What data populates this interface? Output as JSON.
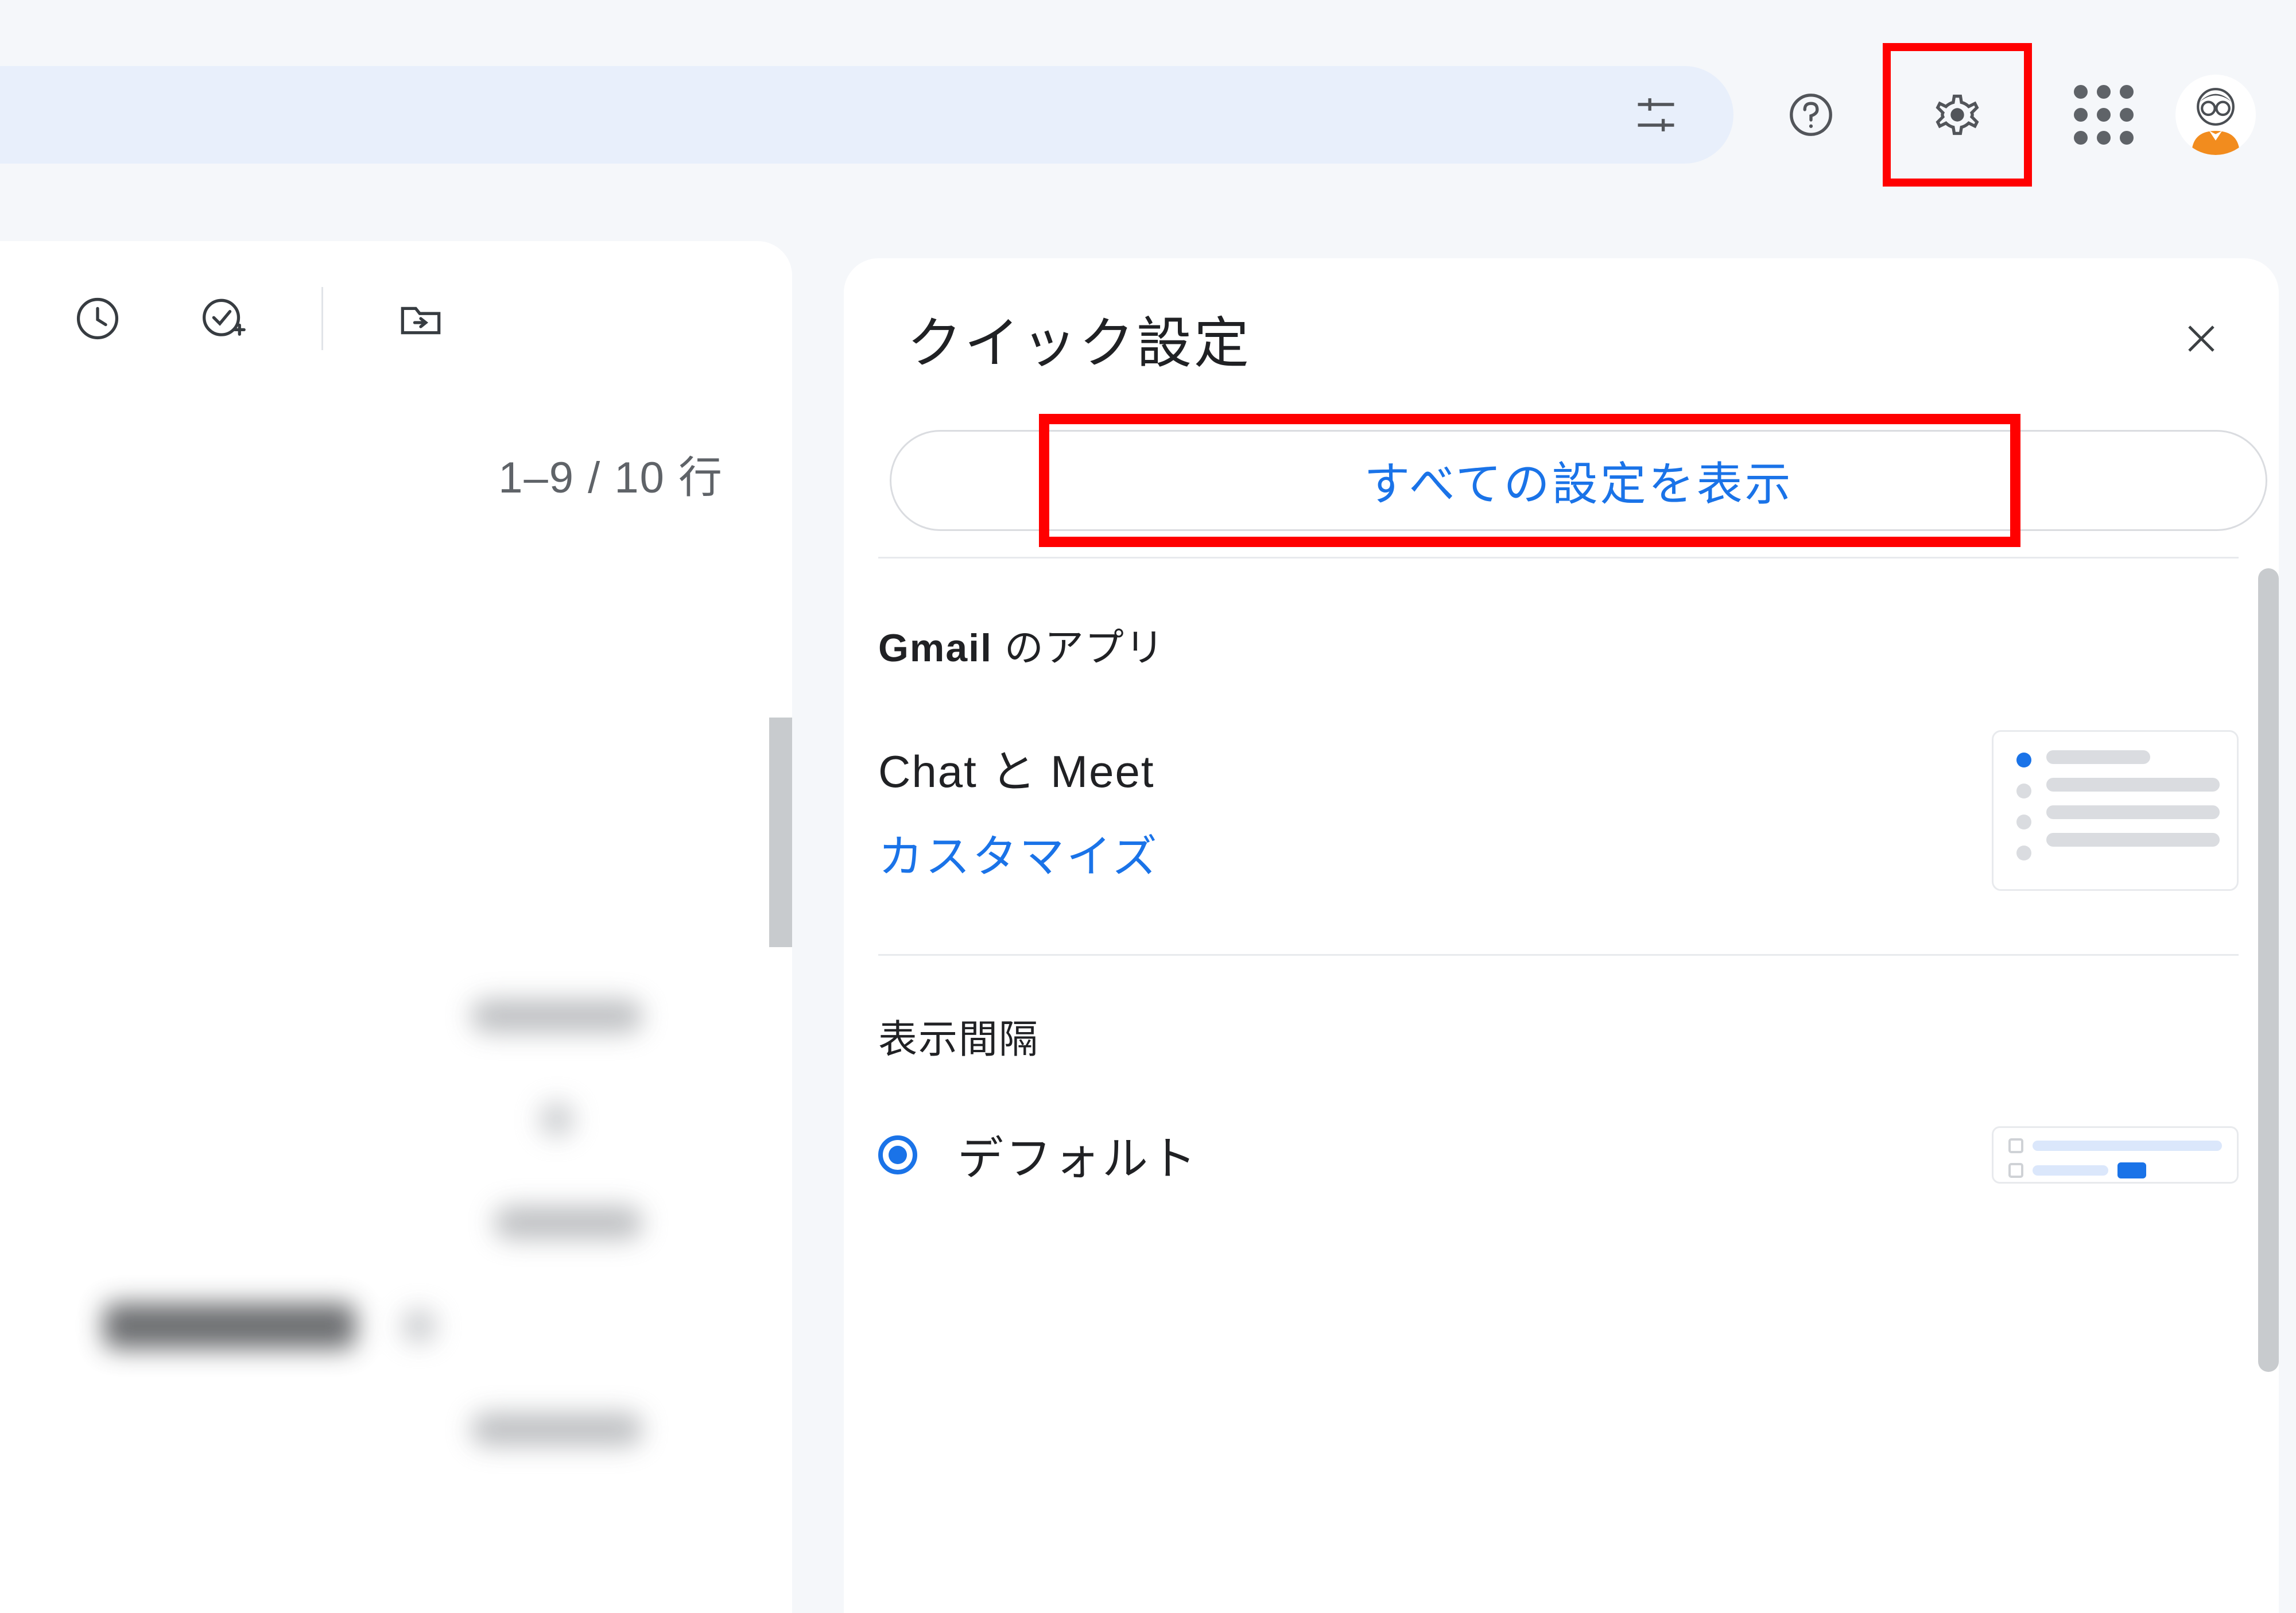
{
  "header": {
    "icons": {
      "tuner": "advanced-search-icon",
      "help": "help-icon",
      "settings": "settings-gear-icon",
      "apps": "google-apps-icon",
      "avatar": "account-avatar"
    }
  },
  "left": {
    "pagination": "1–9 / 10 行"
  },
  "settings_panel": {
    "title": "クイック設定",
    "show_all": "すべての設定を表示",
    "section_apps": {
      "title_bold": "Gmail",
      "title_rest": " のアプリ",
      "chat_meet_label": "Chat と Meet",
      "customize_link": "カスタマイズ"
    },
    "section_density": {
      "title": "表示間隔",
      "default_label": "デフォルト"
    }
  },
  "highlight_color": "#ff0000"
}
